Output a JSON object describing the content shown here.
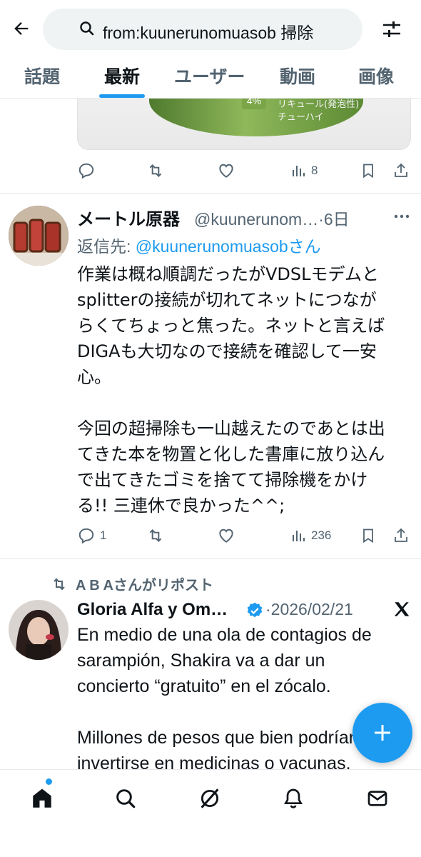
{
  "search": {
    "query": "from:kuunerunomuasob 掃除"
  },
  "tabs": [
    {
      "label": "話題"
    },
    {
      "label": "最新"
    },
    {
      "label": "ユーザー"
    },
    {
      "label": "動画"
    },
    {
      "label": "画像"
    }
  ],
  "active_tab": "最新",
  "prev_tweet": {
    "media_text_1": "リキュール(発泡性)",
    "media_text_2": "チューハイ",
    "media_badge": "4%",
    "views": "8"
  },
  "tweet1": {
    "name": "メートル原器",
    "handle_time": "@kuunerunom…·6日",
    "reply_prefix": "返信先: ",
    "reply_mention": "@kuunerunomuasobさん",
    "text": "作業は概ね順調だったがVDSLモデムと\nsplitterの接続が切れてネットにつなが\nらくてちょっと焦った。ネットと言えば\nDIGAも大切なので接続を確認して一安\n心。\n\n今回の超掃除も一山越えたのであとは出\nてきた本を物置と化した書庫に放り込ん\nで出てきたゴミを捨てて掃除機をかけ\nる!! 三連休で良かった^^;",
    "replies": "1",
    "views": "236"
  },
  "tweet2": {
    "repost_label": "A B Aさんがリポスト",
    "name": "Gloria Alfa y Om…",
    "date": "·2026/02/21",
    "text": "En medio de una ola de contagios de\nsarampión, Shakira va a dar un\nconcierto “gratuito” en el zócalo.\n\nMillones de pesos que bien podrían\ninvertirse en medicinas o vacunas."
  },
  "colors": {
    "accent": "#1d9bf0",
    "muted": "#536471",
    "text": "#0f1419"
  },
  "icons": [
    "back-arrow-icon",
    "search-icon",
    "filter-icon",
    "reply-icon",
    "repost-icon",
    "like-icon",
    "views-icon",
    "bookmark-icon",
    "share-icon",
    "more-icon",
    "verified-icon",
    "x-logo-icon",
    "compose-plus-icon",
    "home-icon",
    "explore-icon",
    "grok-icon",
    "notifications-icon",
    "messages-icon"
  ]
}
